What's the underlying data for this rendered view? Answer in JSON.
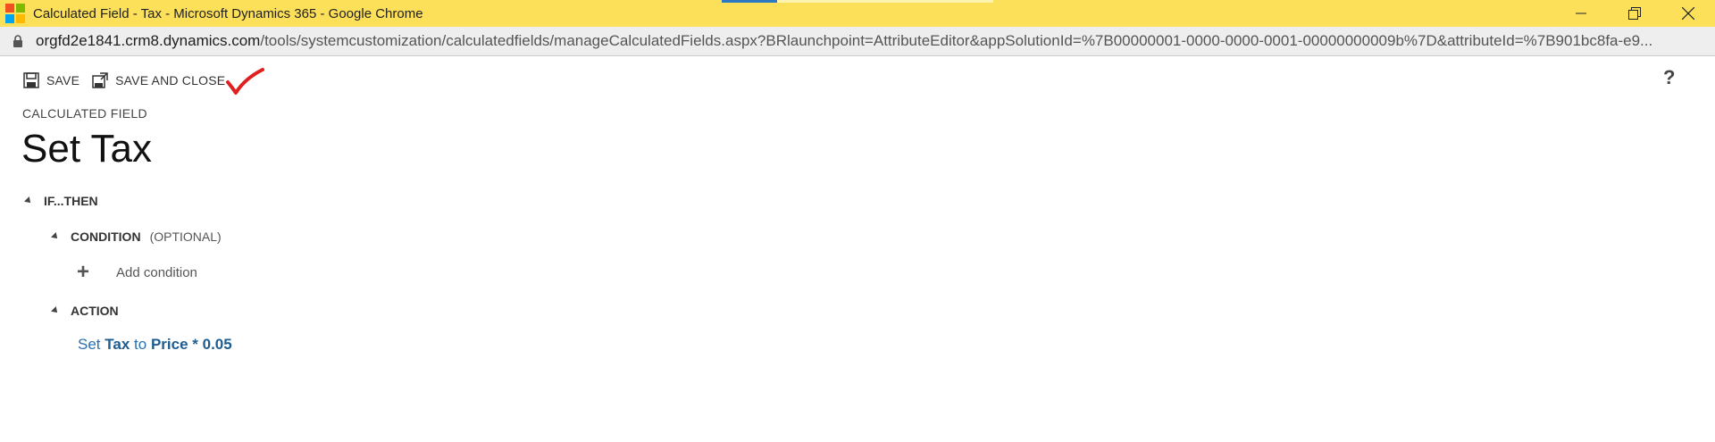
{
  "window": {
    "title": "Calculated Field - Tax - Microsoft Dynamics 365 - Google Chrome",
    "logo_colors": [
      "#f25022",
      "#7fba00",
      "#00a4ef",
      "#ffb900"
    ]
  },
  "address": {
    "host": "orgfd2e1841.crm8.dynamics.com",
    "path": "/tools/systemcustomization/calculatedfields/manageCalculatedFields.aspx?BRlaunchpoint=AttributeEditor&appSolutionId=%7B00000001-0000-0000-0001-00000000009b%7D&attributeId=%7B901bc8fa-e9..."
  },
  "toolbar": {
    "save_label": "SAVE",
    "save_close_label": "SAVE AND CLOSE",
    "help": "?"
  },
  "header": {
    "section": "CALCULATED FIELD",
    "title": "Set Tax"
  },
  "tree": {
    "if_then": "IF...THEN",
    "condition": "CONDITION",
    "condition_optional": "(OPTIONAL)",
    "add_condition": "Add condition",
    "action": "ACTION",
    "action_text": {
      "set": "Set",
      "field": "Tax",
      "to": "to",
      "expression": "Price * 0.05"
    }
  },
  "colors": {
    "titlebar": "#fde05a",
    "link": "#2a6fb0",
    "annotation": "#e02020"
  }
}
